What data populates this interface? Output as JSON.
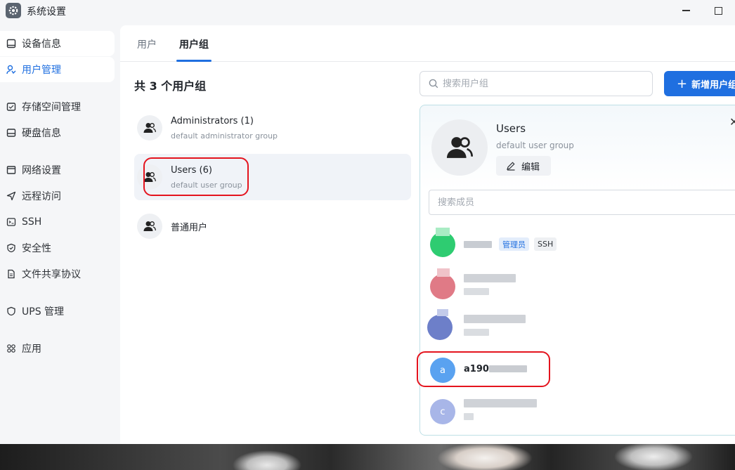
{
  "window": {
    "title": "系统设置"
  },
  "sidebar": {
    "items": [
      {
        "label": "设备信息",
        "icon": "monitor-icon"
      },
      {
        "label": "用户管理",
        "icon": "users-icon"
      },
      {
        "label": "存储空间管理",
        "icon": "storage-icon"
      },
      {
        "label": "硬盘信息",
        "icon": "disk-icon"
      },
      {
        "label": "网络设置",
        "icon": "network-icon"
      },
      {
        "label": "远程访问",
        "icon": "send-icon"
      },
      {
        "label": "SSH",
        "icon": "terminal-icon"
      },
      {
        "label": "安全性",
        "icon": "shield-icon"
      },
      {
        "label": "文件共享协议",
        "icon": "file-icon"
      },
      {
        "label": "UPS 管理",
        "icon": "ups-shield-icon"
      },
      {
        "label": "应用",
        "icon": "apps-icon"
      }
    ],
    "active_index": 1
  },
  "tabs": [
    {
      "label": "用户"
    },
    {
      "label": "用户组"
    }
  ],
  "groups": {
    "count_title": "共 3 个用户组",
    "items": [
      {
        "name": "Administrators (1)",
        "desc": "default administrator group"
      },
      {
        "name": "Users (6)",
        "desc": "default user group"
      },
      {
        "name": "普通用户",
        "desc": ""
      }
    ]
  },
  "search": {
    "placeholder": "搜索用户组"
  },
  "add_button": {
    "label": "新增用户组"
  },
  "detail": {
    "name": "Users",
    "desc": "default user group",
    "edit_label": "编辑",
    "member_search_placeholder": "搜索成员",
    "members": [
      {
        "badges": [
          "管理员",
          "SSH"
        ],
        "avatar_color": "#2ecc71"
      },
      {
        "avatar_color": "#e07a86"
      },
      {
        "avatar_color": "#6d7fc9"
      },
      {
        "avatar_letter": "a",
        "label": "a190",
        "avatar_color": "#5aa2f0"
      },
      {
        "avatar_letter": "c",
        "avatar_color": "#a8b6e8"
      }
    ]
  }
}
